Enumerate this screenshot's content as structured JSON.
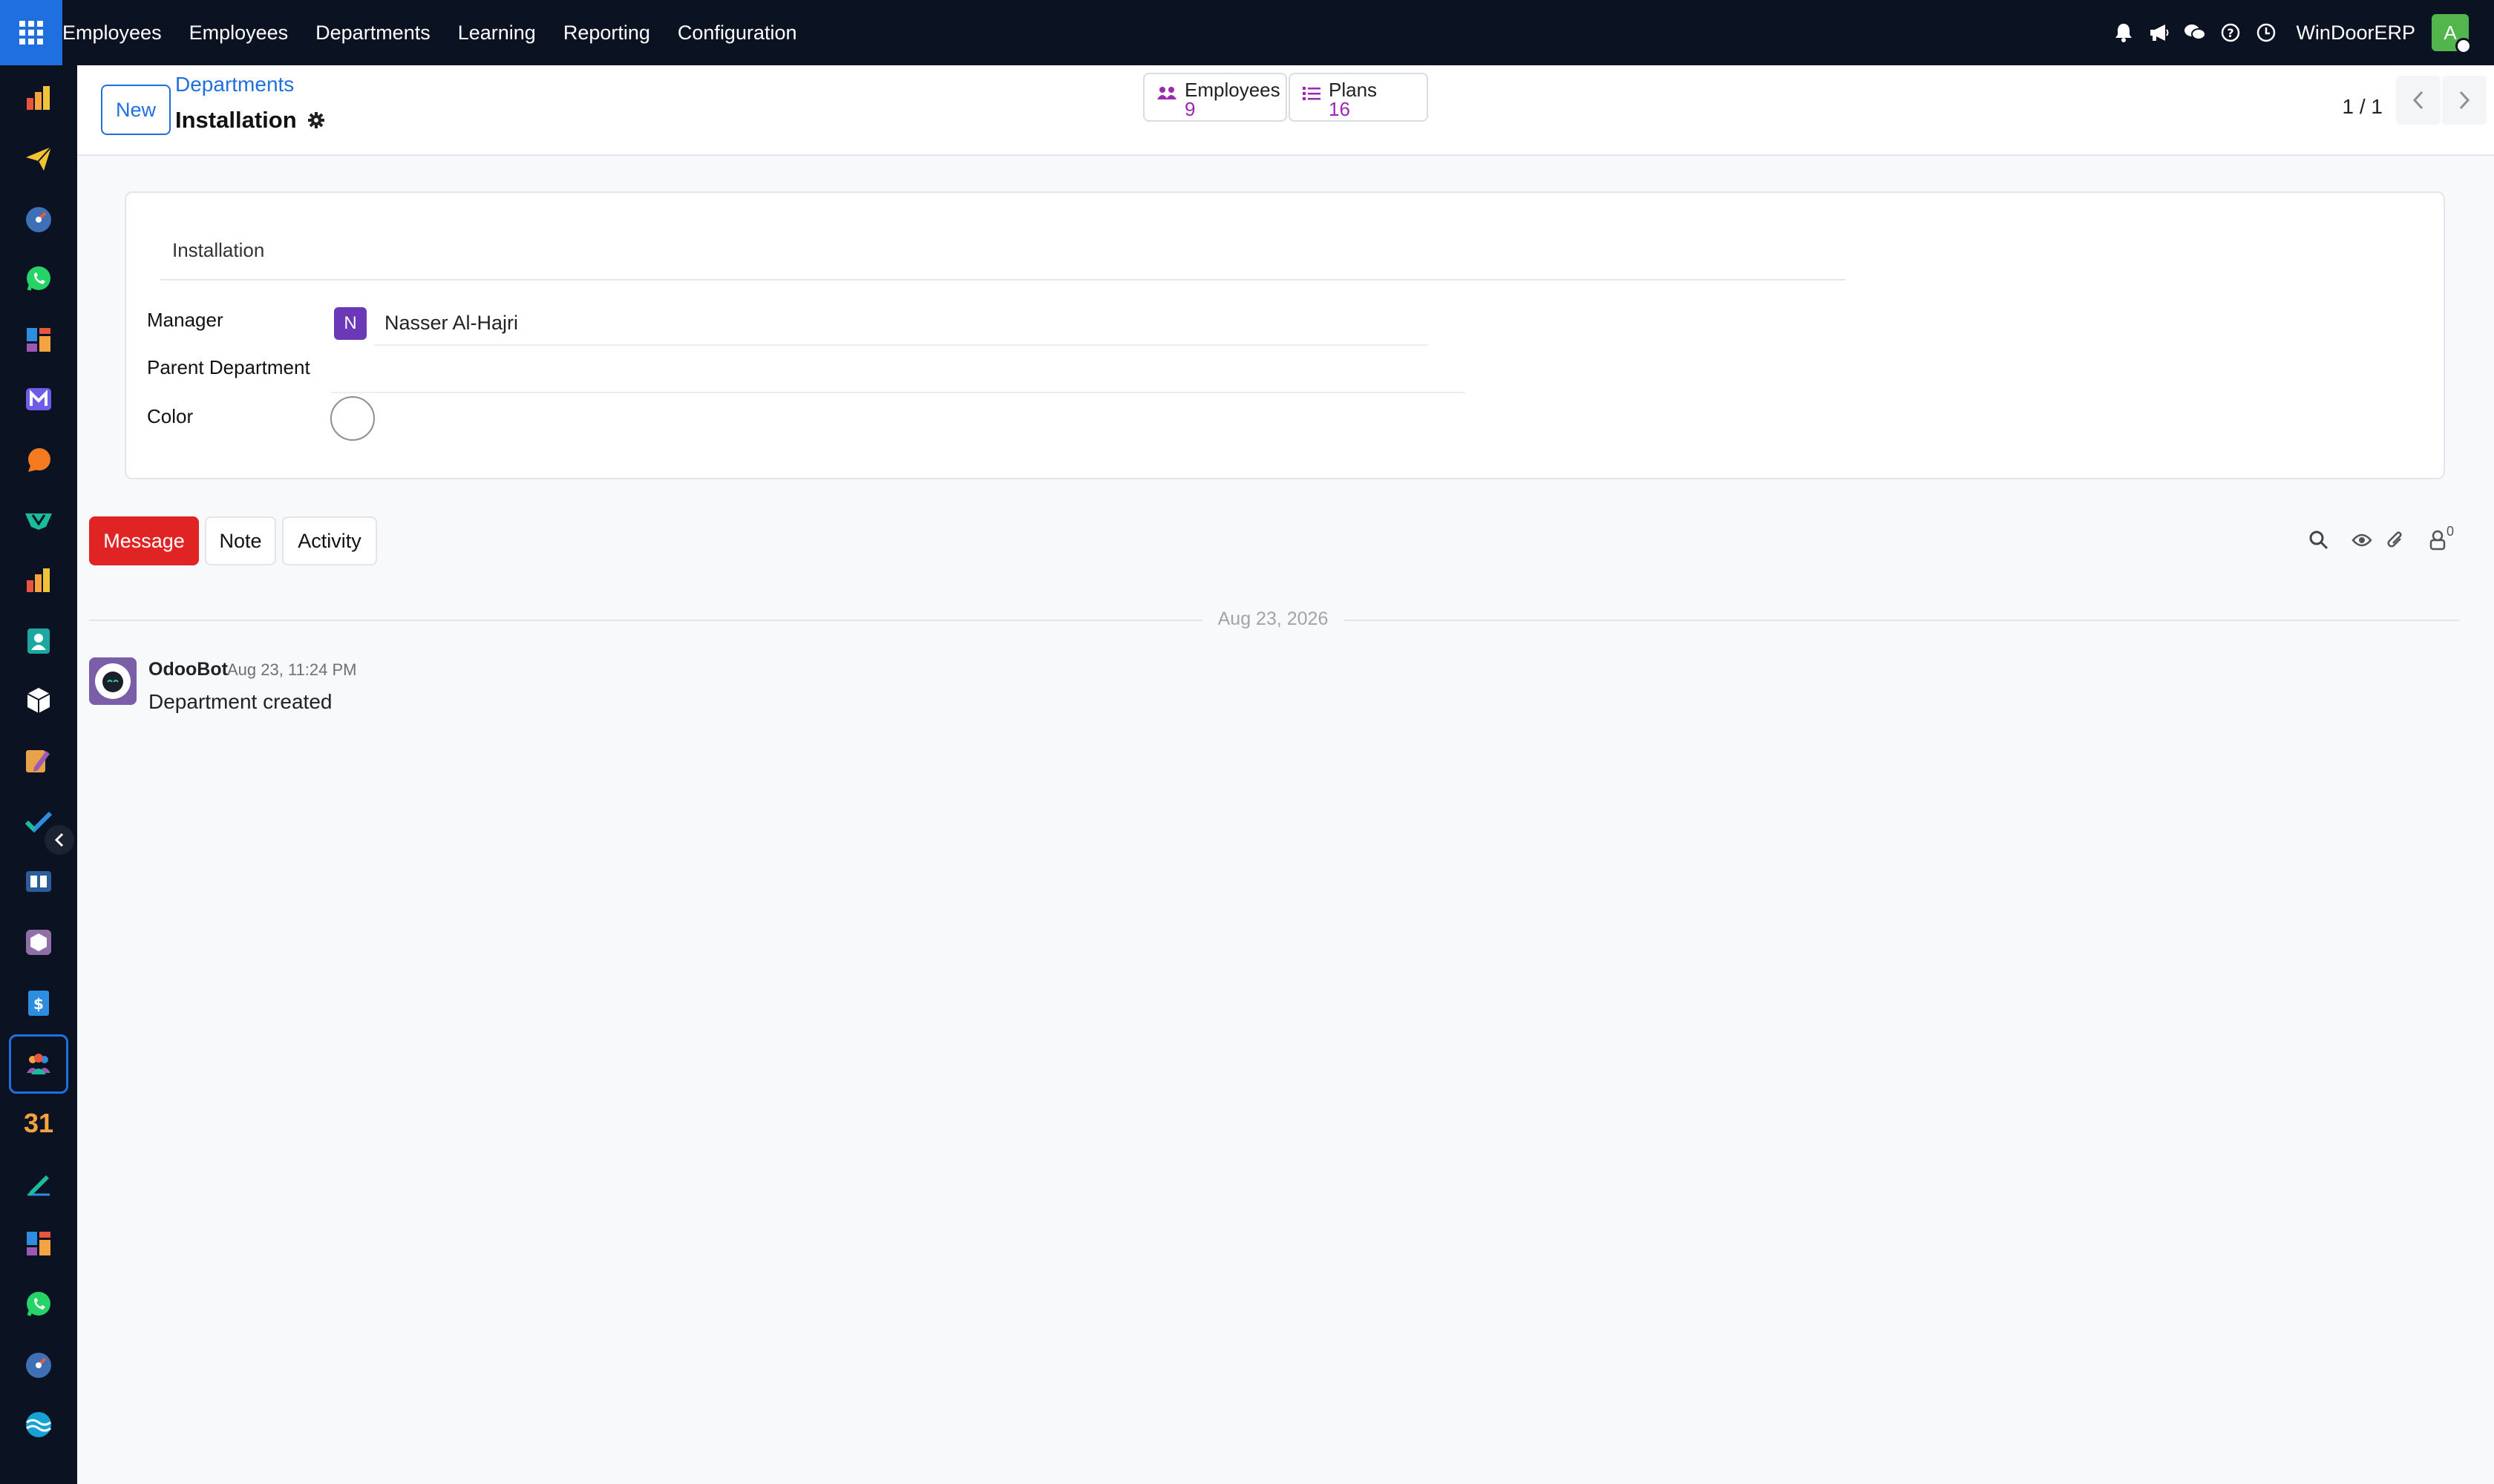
{
  "topbar": {
    "menu": [
      "Employees",
      "Employees",
      "Departments",
      "Learning",
      "Reporting",
      "Configuration"
    ],
    "company": "WinDoorERP",
    "user_initial": "A",
    "icons": [
      "bell-icon",
      "megaphone-icon",
      "chat-bubbles-icon",
      "help-icon",
      "clock-icon"
    ]
  },
  "sidebar": {
    "apps": [
      "chart-app-icon",
      "send-app-icon",
      "gauge-app-icon",
      "whatsapp-app-icon",
      "dashboard-app-icon",
      "mail-app-icon",
      "chat-app-icon",
      "ticket-app-icon",
      "chart-app-icon",
      "contacts-app-icon",
      "cube-app-icon",
      "pen-app-icon",
      "check-app-icon",
      "book-app-icon",
      "box-app-icon",
      "invoice-app-icon",
      "employees-app-icon",
      "calendar-app-icon",
      "sign-app-icon",
      "dashboard-app-icon",
      "whatsapp-app-icon",
      "gauge-app-icon",
      "wave-app-icon"
    ],
    "calendar_label": "31"
  },
  "control": {
    "new_label": "New",
    "breadcrumb": "Departments",
    "title": "Installation",
    "smart_buttons": [
      {
        "label": "Employees",
        "count": "9"
      },
      {
        "label": "Plans",
        "count": "16"
      }
    ],
    "pager": "1 / 1"
  },
  "form": {
    "name": "Installation",
    "manager_label": "Manager",
    "manager_initial": "N",
    "manager_name": "Nasser Al-Hajri",
    "parent_label": "Parent Department",
    "color_label": "Color"
  },
  "chatter": {
    "message_label": "Message",
    "note_label": "Note",
    "activity_label": "Activity",
    "followers": "0",
    "date_separator": "Aug 23, 2026",
    "messages": [
      {
        "author": "OdooBot",
        "date": "Aug 23, 11:24 PM",
        "body": "Department created"
      }
    ]
  },
  "colors": {
    "topbar_bg": "#0b1222",
    "primary": "#1f6fe0",
    "message_button": "#e02424",
    "count": "#9c27b0",
    "manager_avatar": "#6b39b8"
  }
}
